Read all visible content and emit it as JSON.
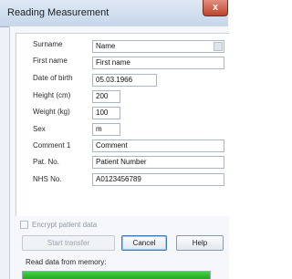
{
  "window": {
    "title": "Reading Measurement",
    "close_glyph": "x"
  },
  "form": {
    "surname": {
      "label": "Surname",
      "value": "Name"
    },
    "firstname": {
      "label": "First name",
      "value": "First name"
    },
    "dob": {
      "label": "Date of birth",
      "value": "05.03.1966"
    },
    "height": {
      "label": "Height (cm)",
      "value": "200"
    },
    "weight": {
      "label": "Weight (kg)",
      "value": "100"
    },
    "sex": {
      "label": "Sex",
      "value": "m"
    },
    "comment1": {
      "label": "Comment 1",
      "value": "Comment"
    },
    "patno": {
      "label": "Pat. No.",
      "value": "Patient Number"
    },
    "nhsno": {
      "label": "NHS No.",
      "value": "A0123456789"
    }
  },
  "encrypt": {
    "label": "Encrypt patient data",
    "checked": false,
    "enabled": false
  },
  "buttons": {
    "start_transfer": "Start transfer",
    "cancel": "Cancel",
    "help": "Help"
  },
  "progress": {
    "label": "Read data from memory:",
    "percent": 100,
    "color": "#2fbf2f"
  },
  "colors": {
    "titlebar": "#c6d7ea",
    "close": "#c0442c",
    "window_bg": "#eef2f6"
  }
}
